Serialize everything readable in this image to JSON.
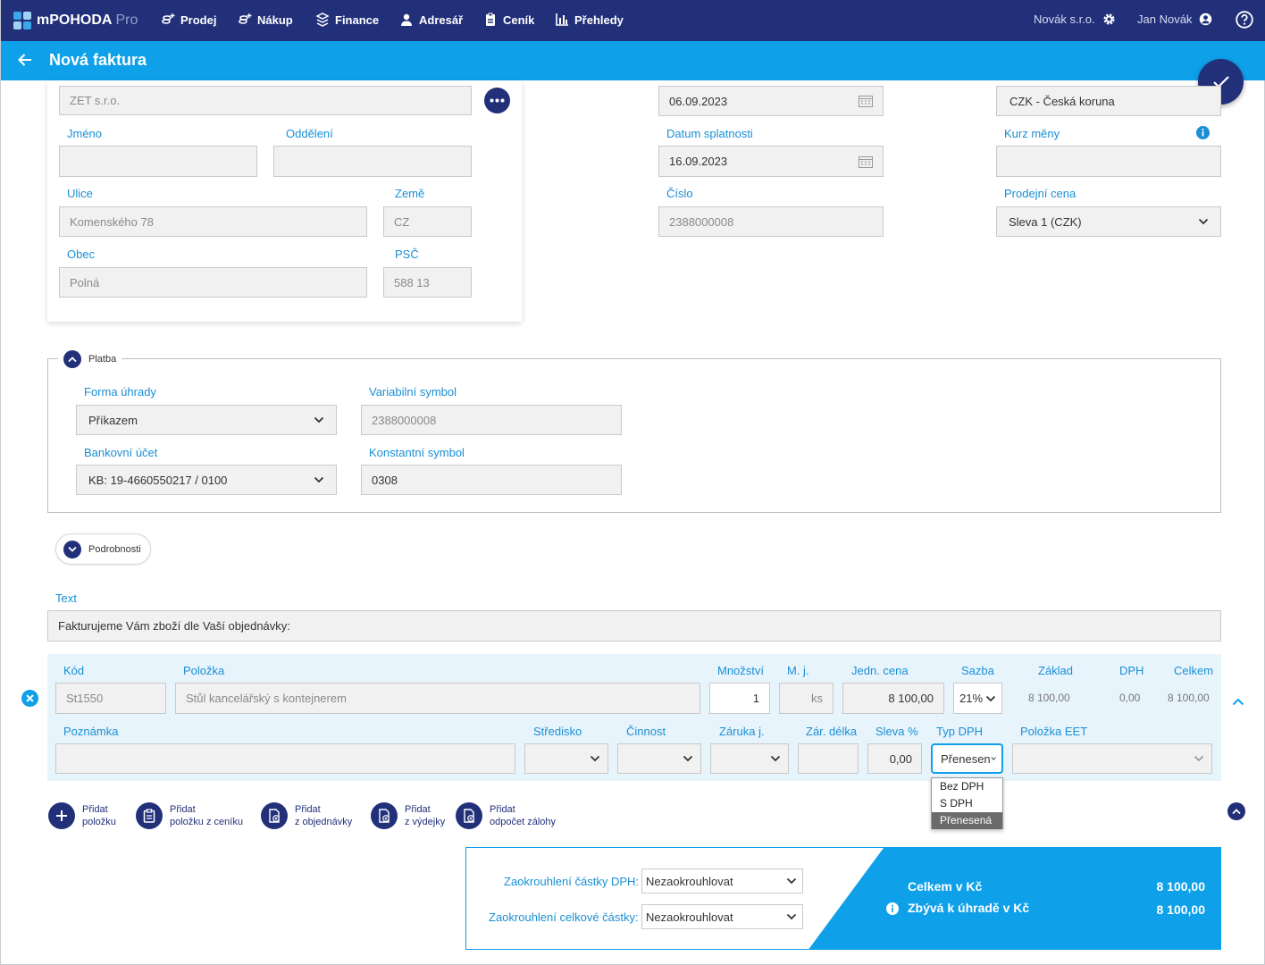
{
  "app": {
    "name": "mPOHODA",
    "edition": "Pro"
  },
  "nav": [
    {
      "label": "Prodej",
      "icon": "coins-plus-icon"
    },
    {
      "label": "Nákup",
      "icon": "coins-plus-icon"
    },
    {
      "label": "Finance",
      "icon": "finance-icon"
    },
    {
      "label": "Adresář",
      "icon": "person-icon"
    },
    {
      "label": "Ceník",
      "icon": "pricelist-icon"
    },
    {
      "label": "Přehledy",
      "icon": "bar-chart-icon"
    }
  ],
  "company": "Novák s.r.o.",
  "user": "Jan Novák",
  "page_title": "Nová faktura",
  "partner": {
    "company": "ZET s.r.o.",
    "jmeno_label": "Jméno",
    "jmeno": "",
    "oddeleni_label": "Oddělení",
    "oddeleni": "",
    "ulice_label": "Ulice",
    "ulice": "Komenského 78",
    "zeme_label": "Země",
    "zeme": "CZ",
    "obec_label": "Obec",
    "obec": "Polná",
    "psc_label": "PSČ",
    "psc": "588 13"
  },
  "dates": {
    "datum": "06.09.2023",
    "splatnost_label": "Datum splatnosti",
    "splatnost": "16.09.2023",
    "cislo_label": "Číslo",
    "cislo": "2388000008"
  },
  "currency": {
    "mena": "CZK - Česká koruna",
    "kurz_label": "Kurz měny",
    "kurz": "",
    "cena_label": "Prodejní cena",
    "cena": "Sleva 1 (CZK)"
  },
  "platba": {
    "legend": "Platba",
    "forma_label": "Forma úhrady",
    "forma": "Příkazem",
    "vs_label": "Variabilní symbol",
    "vs": "2388000008",
    "ucet_label": "Bankovní účet",
    "ucet": "KB: 19-4660550217 / 0100",
    "ks_label": "Konstantní symbol",
    "ks": "0308"
  },
  "podrobnosti": "Podrobnosti",
  "text": {
    "label": "Text",
    "value": "Fakturujeme Vám zboží dle Vaší objednávky:"
  },
  "item": {
    "h_kod": "Kód",
    "h_polozka": "Položka",
    "h_mnozstvi": "Množství",
    "h_mj": "M. j.",
    "h_cena": "Jedn. cena",
    "h_sazba": "Sazba",
    "h_zaklad": "Základ",
    "h_dph": "DPH",
    "h_celkem": "Celkem",
    "kod": "St1550",
    "polozka": "Stůl kancelářský s kontejnerem",
    "mnozstvi": "1",
    "mj": "ks",
    "cena": "8 100,00",
    "sazba": "21%",
    "zaklad": "8 100,00",
    "dph": "0,00",
    "celkem": "8 100,00",
    "h_poznamka": "Poznámka",
    "h_stredisko": "Středisko",
    "h_cinnost": "Činnost",
    "h_zaruka": "Záruka j.",
    "h_zardelka": "Zár. délka",
    "h_sleva": "Sleva %",
    "h_typdph": "Typ DPH",
    "h_eet": "Položka EET",
    "sleva": "0,00",
    "typdph": "Přenesen"
  },
  "typdph_options": [
    "Bez DPH",
    "S DPH",
    "Přenesená"
  ],
  "add_buttons": [
    {
      "l1": "Přidat",
      "l2": "položku"
    },
    {
      "l1": "Přidat",
      "l2": "položku z ceníku"
    },
    {
      "l1": "Přidat",
      "l2": "z objednávky"
    },
    {
      "l1": "Přidat",
      "l2": "z výdejky"
    },
    {
      "l1": "Přidat",
      "l2": "odpočet zálohy"
    }
  ],
  "rounding": {
    "dph_label": "Zaokrouhlení částky DPH:",
    "dph": "Nezaokrouhlovat",
    "total_label": "Zaokrouhlení celkové částky:",
    "total": "Nezaokrouhlovat"
  },
  "totals": {
    "celkem_label": "Celkem v Kč",
    "celkem": "8 100,00",
    "zbyva_label": "Zbývá k úhradě v Kč",
    "zbyva": "8 100,00"
  },
  "colors": {
    "navy": "#22307a",
    "blue": "#0fa0ea",
    "label": "#1a8fd4"
  }
}
